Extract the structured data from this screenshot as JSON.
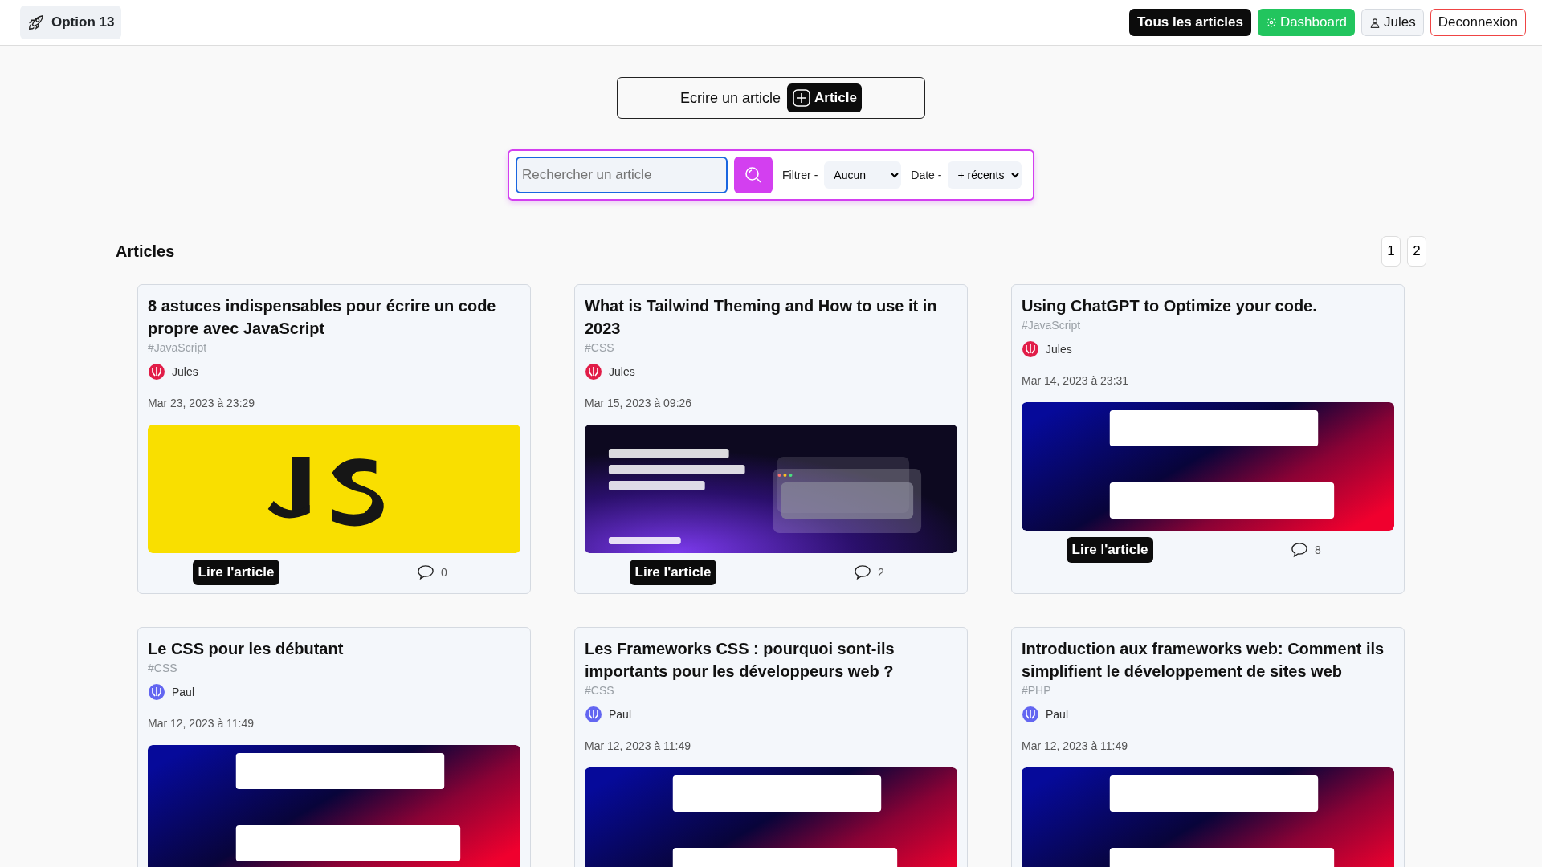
{
  "navbar": {
    "brand": "Option 13",
    "buttons": [
      {
        "label": "Tous les articles",
        "kind": "dark"
      },
      {
        "label": "Dashboard",
        "kind": "success"
      },
      {
        "label": "Jules",
        "kind": "user"
      },
      {
        "label": "Deconnexion",
        "kind": "danger"
      }
    ]
  },
  "write": {
    "text": "Ecrire un article",
    "button": "Article"
  },
  "search": {
    "placeholder": "Rechercher un article",
    "focused": true,
    "filter_label": "Filtrer -",
    "filter_value": "Aucun",
    "date_label": "Date -",
    "date_value": "+ récents"
  },
  "section_title": "Articles",
  "pagination": [
    "1",
    "2"
  ],
  "articles": [
    {
      "title": "8 astuces indispensables pour écrire un code propre avec JavaScript",
      "tag": "#JavaScript",
      "author": {
        "name": "Jules",
        "color": "#e11d48"
      },
      "date": "Mar 23, 2023 à 23:29",
      "cover": {
        "kind": "yellow"
      },
      "button": "Lire l'article",
      "comments": "0"
    },
    {
      "title": "What is Tailwind Theming and How to use it in 2023",
      "tag": "#CSS",
      "author": {
        "name": "Jules",
        "color": "#e11d48"
      },
      "date": "Mar 15, 2023 à 09:26",
      "cover": {
        "kind": "violet"
      },
      "button": "Lire l'article",
      "comments": "2"
    },
    {
      "title": "Using ChatGPT to Optimize your code.",
      "tag": "#JavaScript",
      "author": {
        "name": "Jules",
        "color": "#e11d48"
      },
      "date": "Mar 14, 2023 à 23:31",
      "cover": {
        "kind": "gradient"
      },
      "button": "Lire l'article",
      "comments": "8"
    },
    {
      "title": "Le CSS pour les débutant",
      "tag": "#CSS",
      "author": {
        "name": "Paul",
        "color": "#6366f1"
      },
      "date": "Mar 12, 2023 à 11:49",
      "cover": {
        "kind": "gradient"
      }
    },
    {
      "title": "Les Frameworks CSS : pourquoi sont-ils importants pour les développeurs web ?",
      "tag": "#CSS",
      "author": {
        "name": "Paul",
        "color": "#6366f1"
      },
      "date": "Mar 12, 2023 à 11:49",
      "cover": {
        "kind": "gradient"
      }
    },
    {
      "title": "Introduction aux frameworks web: Comment ils simplifient le développement de sites web",
      "tag": "#PHP",
      "author": {
        "name": "Paul",
        "color": "#6366f1"
      },
      "date": "Mar 12, 2023 à 11:49",
      "cover": {
        "kind": "gradient"
      }
    }
  ]
}
